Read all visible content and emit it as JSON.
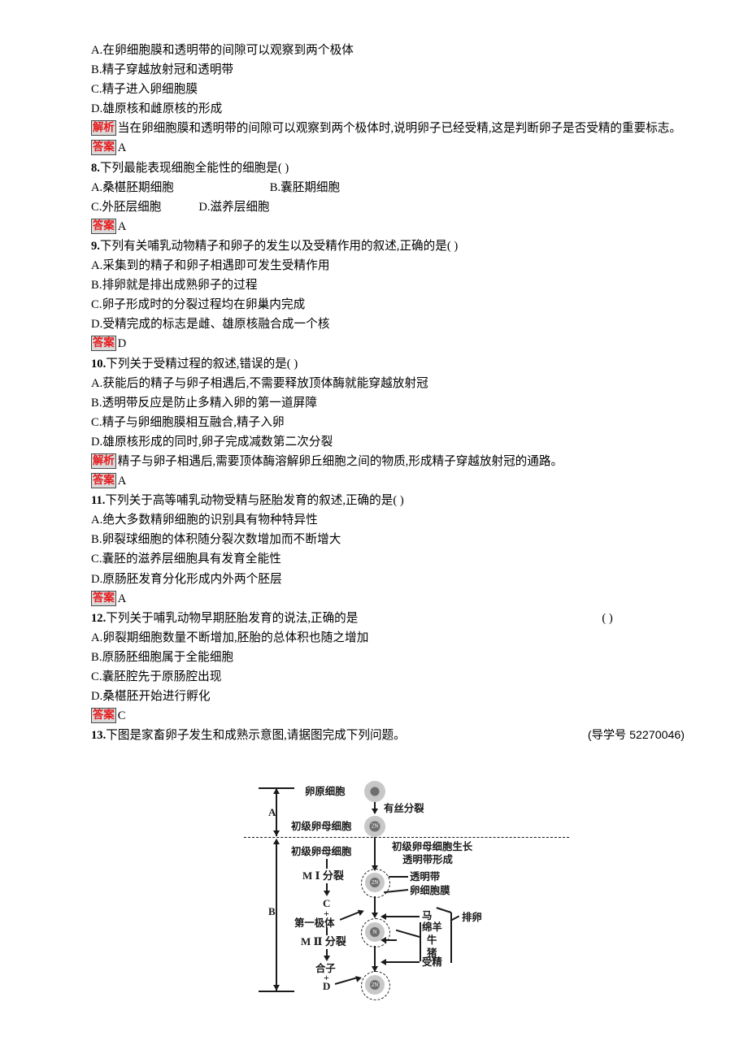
{
  "questions": [
    {
      "id": "q7-options",
      "options": [
        "A.在卵细胞膜和透明带的间隙可以观察到两个极体",
        "B.精子穿越放射冠和透明带",
        "C.精子进入卵细胞膜",
        "D.雄原核和雌原核的形成"
      ],
      "analysis_label": "解析",
      "analysis_text": "当在卵细胞膜和透明带的间隙可以观察到两个极体时,说明卵子已经受精,这是判断卵子是否受精的重要标志。",
      "answer_label": "答案",
      "answer": "A"
    },
    {
      "number": "8.",
      "stem": "下列最能表现细胞全能性的细胞是(        )",
      "options_row1": [
        "A.桑椹胚期细胞",
        "B.囊胚期细胞"
      ],
      "options_row2": [
        "C.外胚层细胞",
        "D.滋养层细胞"
      ],
      "answer_label": "答案",
      "answer": "A"
    },
    {
      "number": "9.",
      "stem": "下列有关哺乳动物精子和卵子的发生以及受精作用的叙述,正确的是(        )",
      "options": [
        "A.采集到的精子和卵子相遇即可发生受精作用",
        "B.排卵就是排出成熟卵子的过程",
        "C.卵子形成时的分裂过程均在卵巢内完成",
        "D.受精完成的标志是雌、雄原核融合成一个核"
      ],
      "answer_label": "答案",
      "answer": "D"
    },
    {
      "number": "10.",
      "stem": "下列关于受精过程的叙述,错误的是(        )",
      "options": [
        "A.获能后的精子与卵子相遇后,不需要释放顶体酶就能穿越放射冠",
        "B.透明带反应是防止多精入卵的第一道屏障",
        "C.精子与卵细胞膜相互融合,精子入卵",
        "D.雄原核形成的同时,卵子完成减数第二次分裂"
      ],
      "analysis_label": "解析",
      "analysis_text": "精子与卵子相遇后,需要顶体酶溶解卵丘细胞之间的物质,形成精子穿越放射冠的通路。",
      "answer_label": "答案",
      "answer": "A"
    },
    {
      "number": "11.",
      "stem": "下列关于高等哺乳动物受精与胚胎发育的叙述,正确的是(        )",
      "options": [
        "A.绝大多数精卵细胞的识别具有物种特异性",
        "B.卵裂球细胞的体积随分裂次数增加而不断增大",
        "C.囊胚的滋养层细胞具有发育全能性",
        "D.原肠胚发育分化形成内外两个胚层"
      ],
      "answer_label": "答案",
      "answer": "A"
    },
    {
      "number": "12.",
      "stem": "下列关于哺乳动物早期胚胎发育的说法,正确的是",
      "stem_tail": "(    )",
      "options": [
        "A.卵裂期细胞数量不断增加,胚胎的总体积也随之增加",
        "B.原肠胚细胞属于全能细胞",
        "C.囊胚腔先于原肠腔出现",
        "D.桑椹胚开始进行孵化"
      ],
      "answer_label": "答案",
      "answer": "C"
    },
    {
      "number": "13.",
      "stem": "下图是家畜卵子发生和成熟示意图,请据图完成下列问题。",
      "tag": "(导学号 52270046)"
    }
  ],
  "diagram": {
    "bracket_a": "A",
    "bracket_b": "B",
    "labels": {
      "oogonium": "卵原细胞",
      "mitosis": "有丝分裂",
      "primary_oocyte_top": "初级卵母细胞",
      "primary_oocyte_left": "初级卵母细胞",
      "growth_note_line1": "初级卵母细胞生长",
      "growth_note_line2": "透明带形成",
      "zona_pellucida": "透明带",
      "oolemma": "卵细胞膜",
      "mi_division": "M Ⅰ 分裂",
      "c_label": "C",
      "plus1": "+",
      "first_polar_body": "第一极体",
      "mii_division": "M Ⅱ 分裂",
      "zygote": "合子",
      "plus2": "+",
      "d_label": "D",
      "horse": "马",
      "sheep": "绵羊",
      "cattle": "牛",
      "pig": "猪",
      "ovulation": "排卵",
      "fertilization": "受精"
    },
    "cell_nuclei": [
      "",
      "2N",
      "2N",
      "N",
      "2N"
    ]
  },
  "colors": {
    "badge_text": "#e8191b",
    "badge_bg": "#d9d9d9",
    "badge_border": "#4a4a4a",
    "ink": "#000000"
  }
}
